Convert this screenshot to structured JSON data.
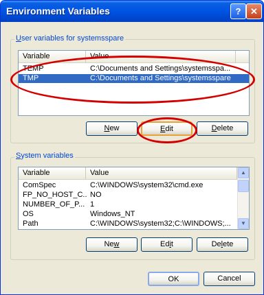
{
  "window": {
    "title": "Environment Variables"
  },
  "titlebar_buttons": {
    "help": "?",
    "close": "✕"
  },
  "user_group": {
    "label_prefix": "U",
    "label_rest": "ser variables for systemsspare",
    "columns": [
      "Variable",
      "Value"
    ],
    "rows": [
      {
        "variable": "TEMP",
        "value": "C:\\Documents and Settings\\systemsspa...",
        "selected": false
      },
      {
        "variable": "TMP",
        "value": "C:\\Documents and Settings\\systemsspare",
        "selected": true
      }
    ],
    "buttons": {
      "new": {
        "acc": "N",
        "rest": "ew"
      },
      "edit": {
        "acc": "E",
        "rest": "dit"
      },
      "delete": {
        "acc": "D",
        "rest": "elete"
      }
    }
  },
  "system_group": {
    "label_prefix": "S",
    "label_rest": "ystem variables",
    "columns": [
      "Variable",
      "Value"
    ],
    "rows": [
      {
        "variable": "ComSpec",
        "value": "C:\\WINDOWS\\system32\\cmd.exe"
      },
      {
        "variable": "FP_NO_HOST_C...",
        "value": "NO"
      },
      {
        "variable": "NUMBER_OF_P...",
        "value": "1"
      },
      {
        "variable": "OS",
        "value": "Windows_NT"
      },
      {
        "variable": "Path",
        "value": "C:\\WINDOWS\\system32;C:\\WINDOWS;..."
      }
    ],
    "buttons": {
      "new": {
        "pre": "Ne",
        "acc": "w",
        "rest": ""
      },
      "edit": {
        "pre": "Ed",
        "acc": "i",
        "rest": "t"
      },
      "delete": {
        "pre": "De",
        "acc": "l",
        "rest": "ete"
      }
    }
  },
  "footer": {
    "ok": "OK",
    "cancel": "Cancel"
  },
  "annotation": {
    "color": "#d40000"
  }
}
